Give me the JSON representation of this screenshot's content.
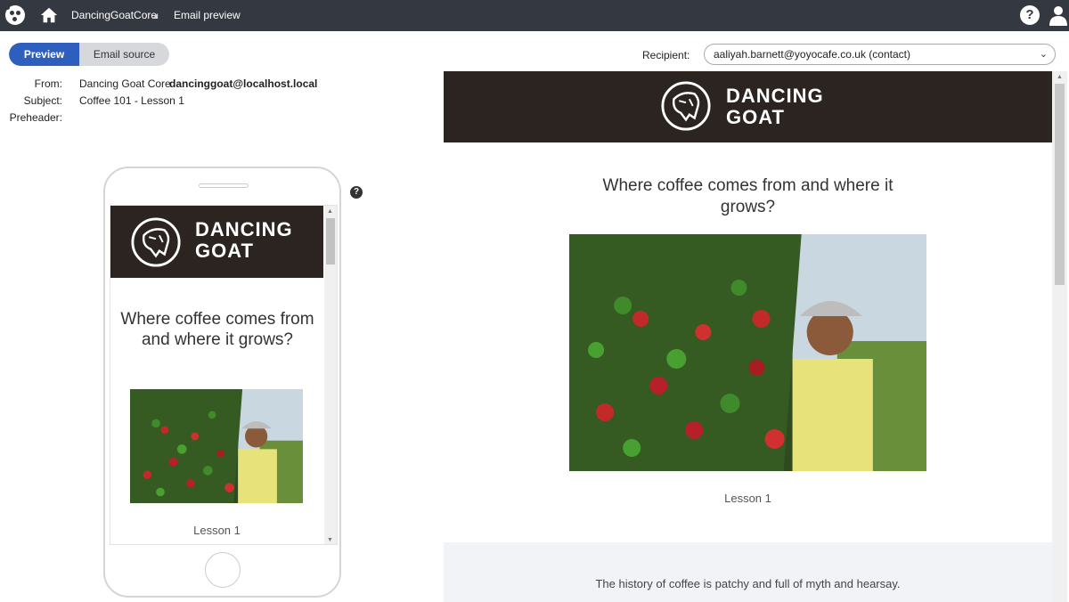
{
  "topbar": {
    "site_name": "DancingGoatCore",
    "page_name": "Email preview"
  },
  "tabs": {
    "preview": "Preview",
    "source": "Email source"
  },
  "meta": {
    "from_label": "From:",
    "from_name": "Dancing Goat Core",
    "from_email": "dancinggoat@localhost.local",
    "subject_label": "Subject:",
    "subject_value": "Coffee 101 - Lesson 1",
    "preheader_label": "Preheader:"
  },
  "recipient": {
    "label": "Recipient:",
    "value": "aaliyah.barnett@yoyocafe.co.uk (contact)"
  },
  "email": {
    "brand_line1": "DANCING",
    "brand_line2": "GOAT",
    "title": "Where coffee comes from and where it grows?",
    "lesson": "Lesson 1",
    "history": "The history of coffee is patchy and full of myth and hearsay."
  },
  "help_icon_glyph": "?",
  "colors": {
    "topbar": "#343841",
    "accent": "#2e5fbe",
    "email_header": "#2b2420"
  }
}
